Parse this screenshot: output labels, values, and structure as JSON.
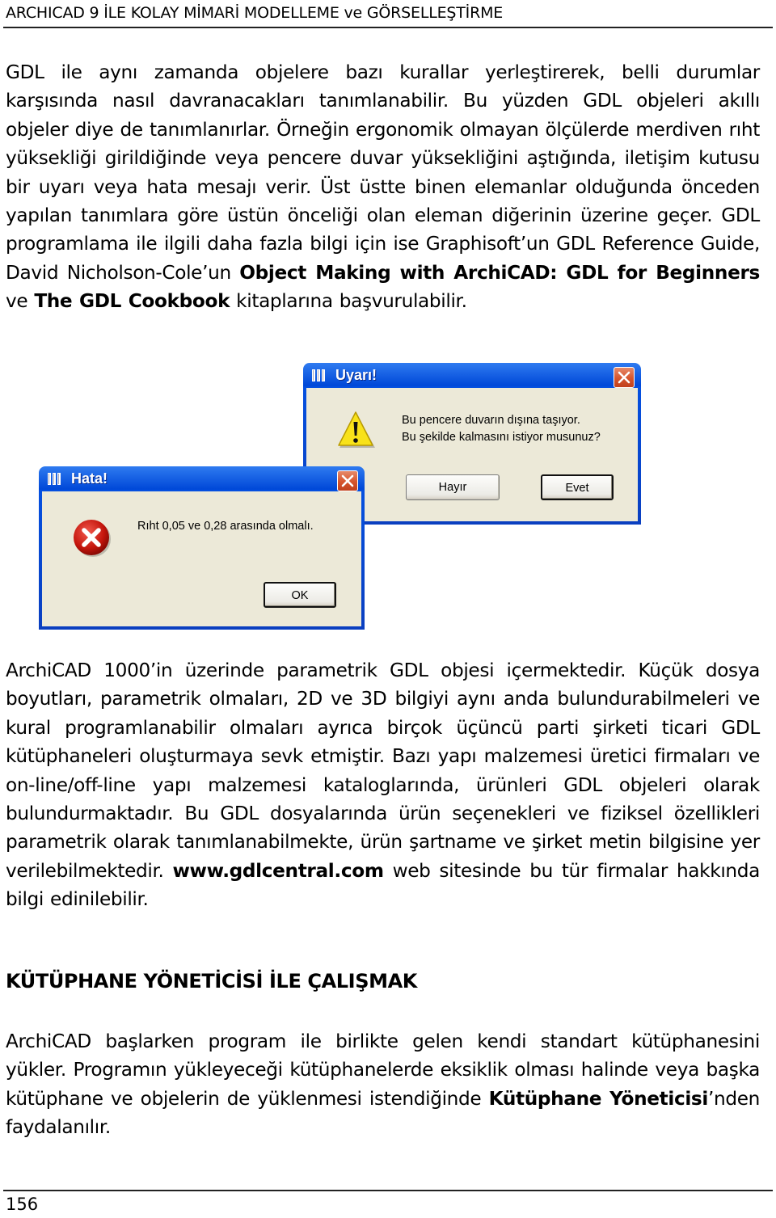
{
  "header": {
    "running_title": "ARCHICAD 9 İLE KOLAY MİMARİ MODELLEME ve GÖRSELLEŞTİRME"
  },
  "paragraph1": {
    "text_a": "GDL ile aynı zamanda objelere bazı kurallar yerleştirerek, belli durumlar karşısında nasıl davranacakları tanımlanabilir. Bu yüzden GDL objeleri akıllı objeler diye de tanımlanırlar. Örneğin ergonomik olmayan ölçülerde merdiven rıht yüksekliği girildiğinde veya pencere duvar yüksekliğini aştığında, iletişim kutusu bir uyarı veya hata mesajı verir. Üst üstte binen elemanlar olduğunda önceden yapılan tanımlara göre üstün önceliği olan eleman diğerinin üzerine geçer. GDL programlama ile ilgili daha fazla bilgi için ise Graphisoft’un GDL Reference Guide, David Nicholson-Cole’un ",
    "bold_b": "Object Making with ArchiCAD: GDL for Beginners",
    "text_c": " ve ",
    "bold_d": "The GDL Cookbook",
    "text_e": " kitaplarına başvurulabilir."
  },
  "warning_dialog": {
    "title": "Uyarı!",
    "icon": "warning-triangle-icon",
    "message_line1": "Bu pencere duvarın dışına taşıyor.",
    "message_line2": "Bu şekilde kalmasını istiyor musunuz?",
    "button_no": "Hayır",
    "button_yes": "Evet"
  },
  "error_dialog": {
    "title": "Hata!",
    "icon": "error-circle-icon",
    "message": "Rıht 0,05 ve 0,28 arasında olmalı.",
    "button_ok": "OK"
  },
  "paragraph2": {
    "text_a": "ArchiCAD 1000’in üzerinde parametrik GDL objesi içermektedir. Küçük dosya boyutları, parametrik olmaları, 2D ve 3D bilgiyi aynı anda bulundurabilmeleri ve kural programlanabilir olmaları ayrıca birçok üçüncü parti şirketi ticari GDL kütüphaneleri oluşturmaya sevk etmiştir.  Bazı yapı malzemesi üretici firmaları ve on-line/off-line yapı malzemesi kataloglarında, ürünleri GDL objeleri olarak bulundurmaktadır. Bu GDL dosyalarında ürün seçenekleri ve fiziksel özellikleri parametrik olarak tanımlanabilmekte, ürün şartname ve şirket metin bilgisine yer verilebilmektedir. ",
    "link": "www.gdlcentral.com",
    "text_c": " web sitesinde bu tür firmalar hakkında bilgi edinilebilir."
  },
  "section": {
    "heading": "KÜTÜPHANE YÖNETİCİSİ İLE ÇALIŞMAK"
  },
  "paragraph3": {
    "text_a": "ArchiCAD başlarken program ile birlikte gelen kendi standart kütüphanesini yükler. Programın yükleyeceği kütüphanelerde eksiklik olması halinde veya başka kütüphane ve objelerin de yüklenmesi istendiğinde ",
    "bold_b": "Kütüphane Yöneticisi",
    "text_c": "’nden faydalanılır."
  },
  "footer": {
    "page_number": "156"
  }
}
